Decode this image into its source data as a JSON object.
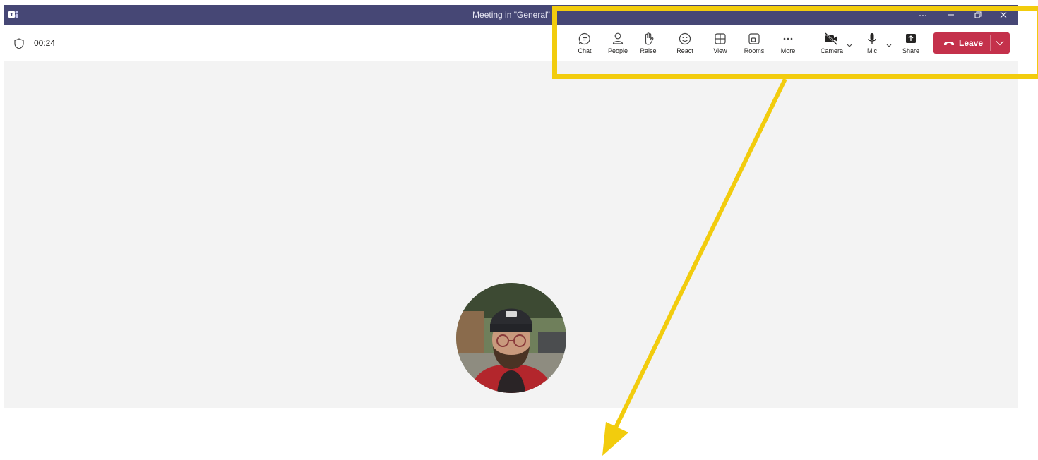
{
  "window": {
    "title": "Meeting in \"General\"",
    "titlebar_color": "#464775"
  },
  "meeting": {
    "timer": "00:24"
  },
  "toolbar": {
    "buttons": [
      {
        "label": "Chat",
        "icon": "chat-icon"
      },
      {
        "label": "People",
        "icon": "people-icon"
      },
      {
        "label": "Raise",
        "icon": "raise-hand-icon"
      },
      {
        "label": "React",
        "icon": "smiley-icon"
      },
      {
        "label": "View",
        "icon": "grid-view-icon"
      },
      {
        "label": "Rooms",
        "icon": "rooms-icon"
      },
      {
        "label": "More",
        "icon": "ellipsis-icon"
      },
      {
        "label": "Camera",
        "icon": "camera-off-icon"
      },
      {
        "label": "Mic",
        "icon": "mic-icon"
      },
      {
        "label": "Share",
        "icon": "share-icon"
      }
    ],
    "leave_label": "Leave",
    "leave_color": "#c4314b"
  },
  "annotation": {
    "highlight_color": "#f2cc0d"
  }
}
